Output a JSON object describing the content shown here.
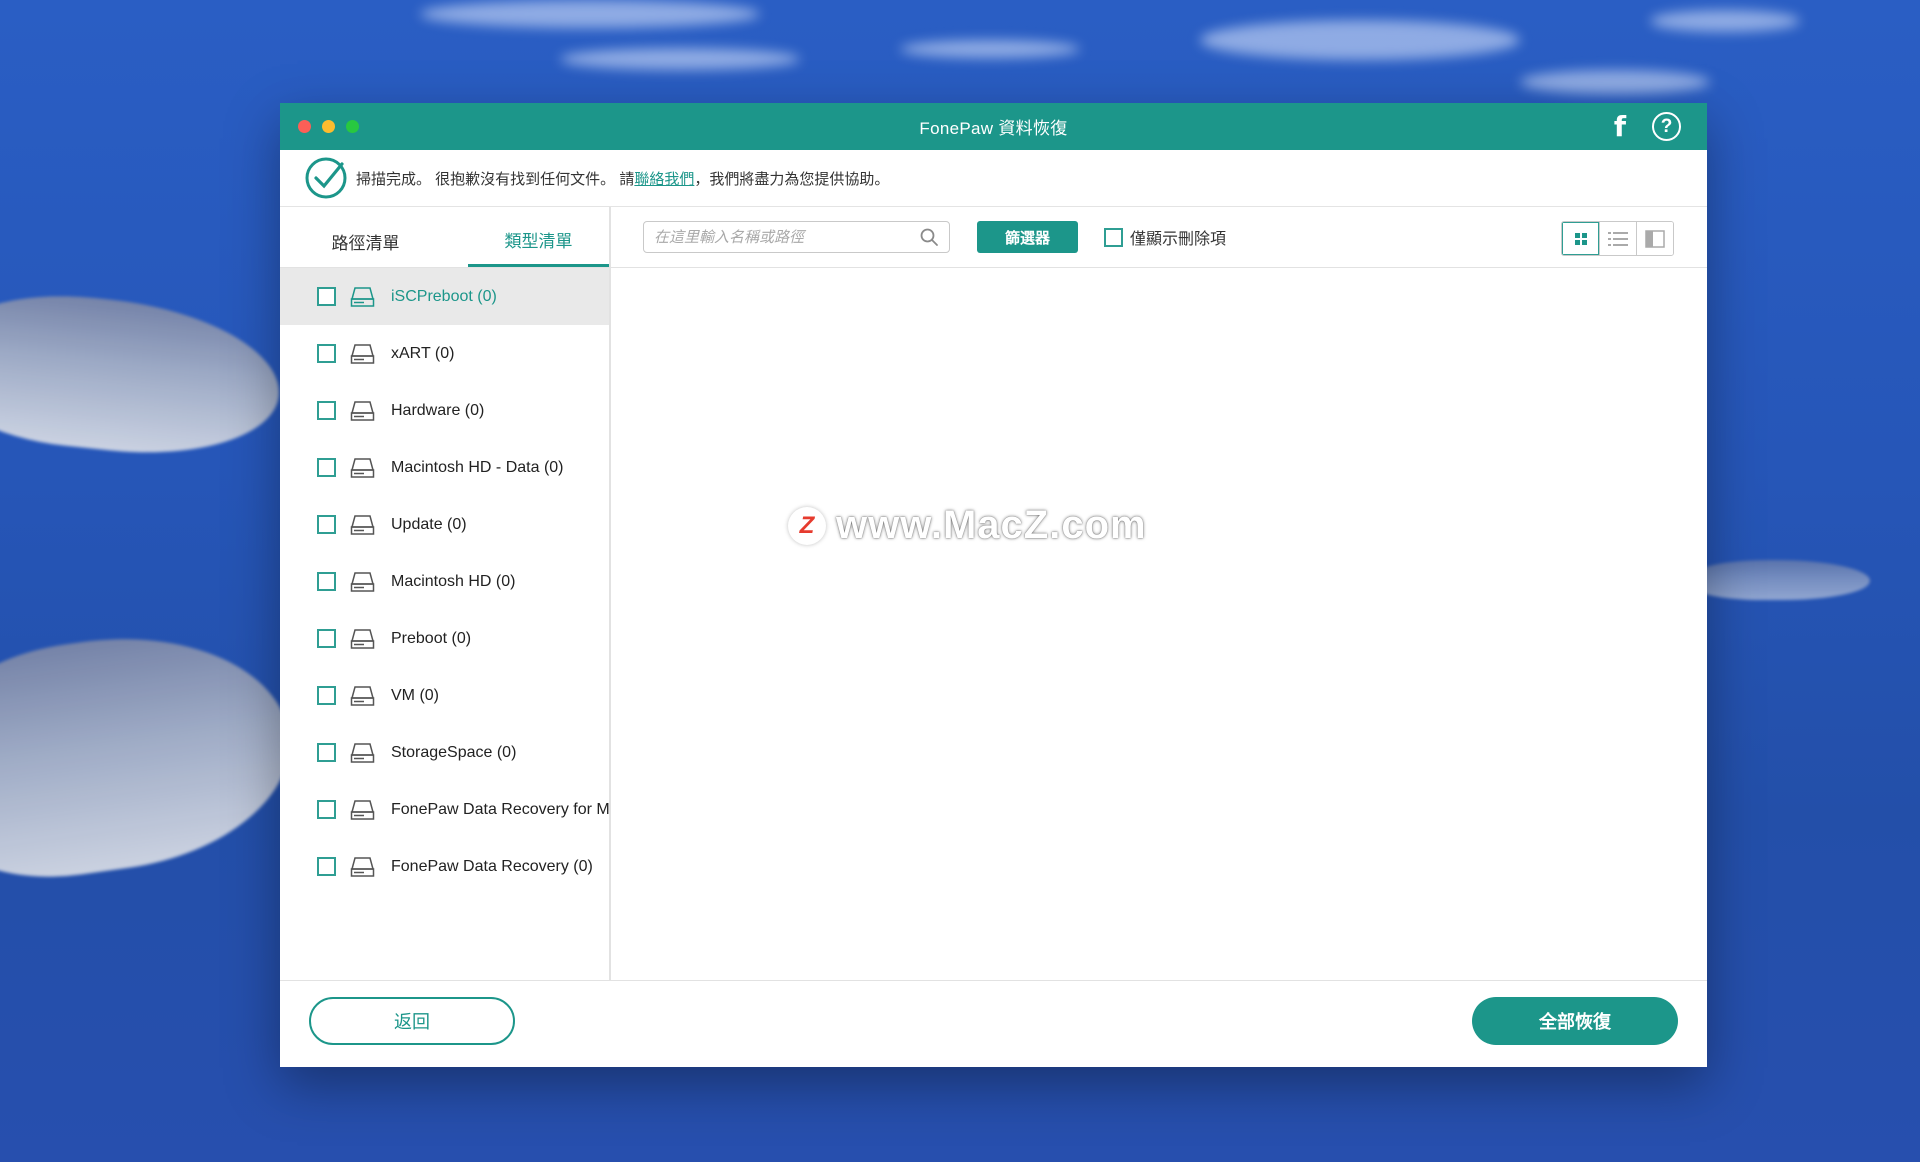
{
  "app": {
    "title": "FonePaw 資料恢復"
  },
  "notice": {
    "text_before": "掃描完成。 很抱歉沒有找到任何文件。 請",
    "link": "聯絡我們",
    "text_after": "，我們將盡力為您提供協助。"
  },
  "sidebar": {
    "tabs": [
      {
        "label": "路徑清單",
        "active": false
      },
      {
        "label": "類型清單",
        "active": true
      }
    ],
    "items": [
      {
        "label": "iSCPreboot (0)",
        "selected": true,
        "checked": false
      },
      {
        "label": "xART (0)",
        "selected": false,
        "checked": false
      },
      {
        "label": "Hardware (0)",
        "selected": false,
        "checked": false
      },
      {
        "label": "Macintosh HD - Data (0)",
        "selected": false,
        "checked": false
      },
      {
        "label": "Update (0)",
        "selected": false,
        "checked": false
      },
      {
        "label": "Macintosh HD (0)",
        "selected": false,
        "checked": false
      },
      {
        "label": "Preboot (0)",
        "selected": false,
        "checked": false
      },
      {
        "label": "VM (0)",
        "selected": false,
        "checked": false
      },
      {
        "label": "StorageSpace (0)",
        "selected": false,
        "checked": false
      },
      {
        "label": "FonePaw Data Recovery for M",
        "selected": false,
        "checked": false
      },
      {
        "label": "FonePaw Data Recovery (0)",
        "selected": false,
        "checked": false
      }
    ]
  },
  "toolbar": {
    "search_placeholder": "在這里輸入名稱或路徑",
    "search_value": "",
    "filter_label": "篩選器",
    "only_deleted_label": "僅顯示刪除項",
    "only_deleted_checked": false,
    "view_modes": [
      "grid",
      "list",
      "detail"
    ],
    "active_view": "grid"
  },
  "watermark": {
    "logo_letter": "Z",
    "text": "www.MacZ.com"
  },
  "footer": {
    "back_label": "返回",
    "recover_all_label": "全部恢復"
  },
  "colors": {
    "accent": "#1c968a",
    "titlebar": "#1c968a",
    "selected_row": "#e9e9e9"
  }
}
